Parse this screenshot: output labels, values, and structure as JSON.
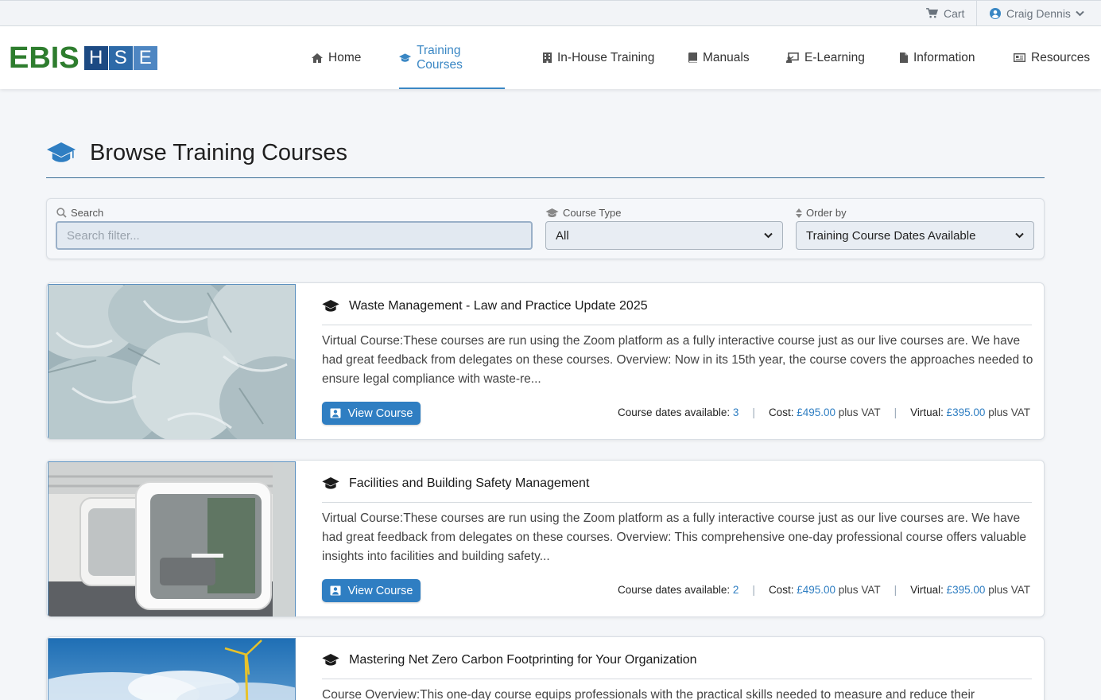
{
  "topbar": {
    "cart_label": "Cart",
    "user_name": "Craig Dennis"
  },
  "logo": {
    "ebis": "EBIS",
    "h": "H",
    "s": "S",
    "e": "E"
  },
  "nav": [
    {
      "label": "Home",
      "icon": "home-icon"
    },
    {
      "label": "Training Courses",
      "icon": "graduation-cap-icon",
      "active": true
    },
    {
      "label": "In-House Training",
      "icon": "building-icon"
    },
    {
      "label": "Manuals",
      "icon": "book-icon"
    },
    {
      "label": "E-Learning",
      "icon": "chalkboard-icon"
    },
    {
      "label": "Information",
      "icon": "file-icon"
    },
    {
      "label": "Resources",
      "icon": "newspaper-icon"
    }
  ],
  "page": {
    "title": "Browse Training Courses"
  },
  "filters": {
    "search_label": "Search",
    "search_placeholder": "Search filter...",
    "type_label": "Course Type",
    "type_value": "All",
    "order_label": "Order by",
    "order_value": "Training Course Dates Available"
  },
  "courses": [
    {
      "title": "Waste Management - Law and Practice Update 2025",
      "description": "Virtual Course:These courses are run using the Zoom platform as a fully interactive course just as our live courses are. We have had great feedback from delegates on these courses. Overview: Now in its 15th year, the course covers the approaches needed to ensure legal compliance with waste-re...",
      "button": "View Course",
      "dates_label": "Course dates available:",
      "dates": "3",
      "cost_label": "Cost:",
      "cost": "£495.00",
      "cost_suffix": "plus VAT",
      "virtual_label": "Virtual:",
      "virtual": "£395.00",
      "virtual_suffix": "plus VAT"
    },
    {
      "title": "Facilities and Building Safety Management",
      "description": "Virtual Course:These courses are run using the Zoom platform as a fully interactive course just as our live courses are. We have had great feedback from delegates on these courses. Overview: This comprehensive one-day professional course offers valuable insights into facilities and building safety...",
      "button": "View Course",
      "dates_label": "Course dates available:",
      "dates": "2",
      "cost_label": "Cost:",
      "cost": "£495.00",
      "cost_suffix": "plus VAT",
      "virtual_label": "Virtual:",
      "virtual": "£395.00",
      "virtual_suffix": "plus VAT"
    },
    {
      "title": "Mastering Net Zero Carbon Footprinting for Your Organization",
      "description": "Course Overview:This one-day course equips professionals with the practical skills needed to measure and reduce their"
    }
  ],
  "colors": {
    "accent": "#2f7ec2",
    "logo_green": "#2e7d2e",
    "logo_blue": "#1c4a83"
  }
}
